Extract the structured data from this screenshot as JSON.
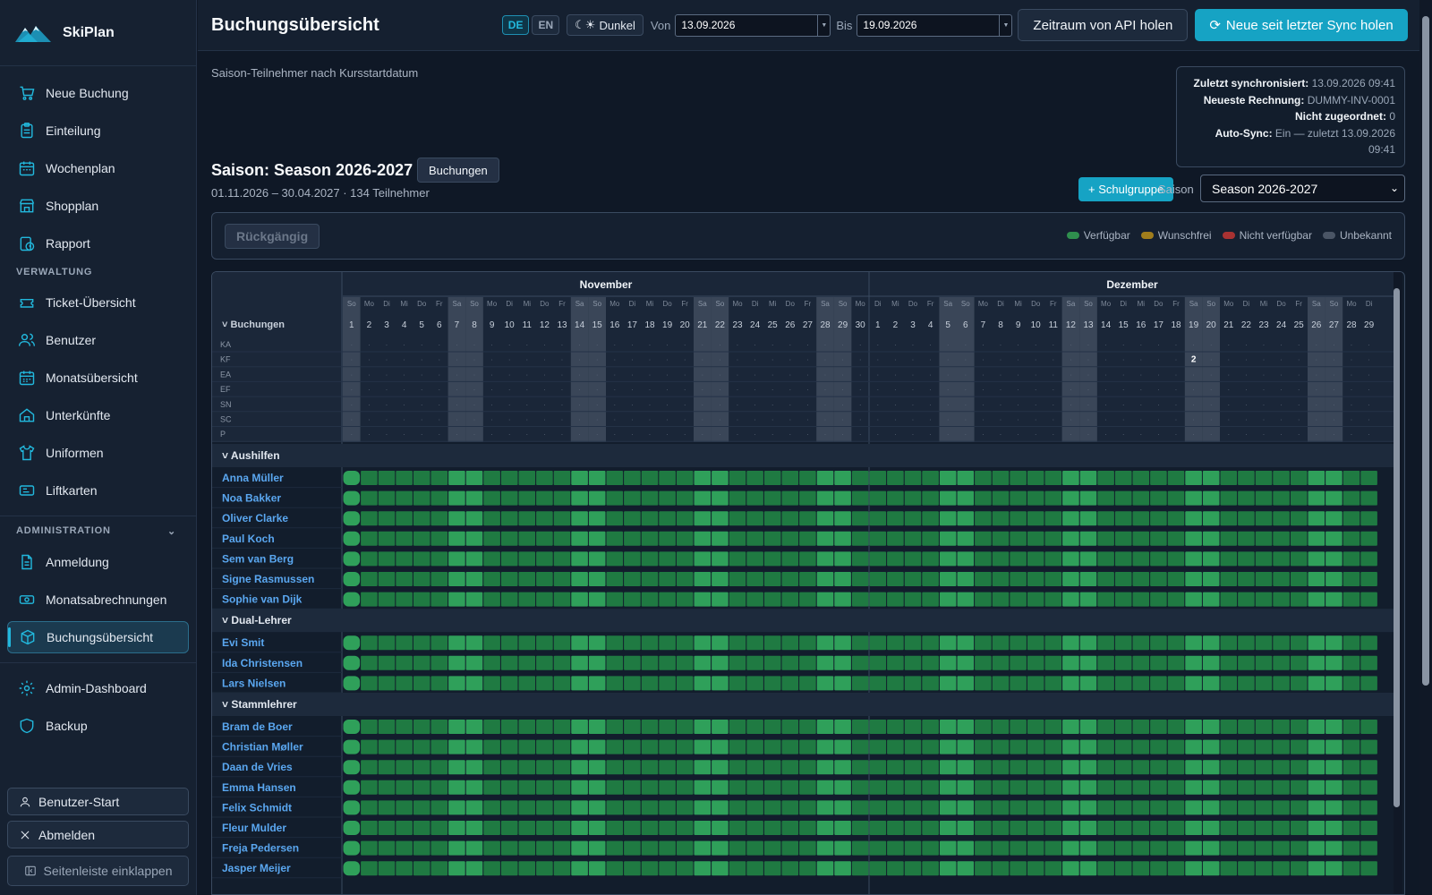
{
  "sidebar": {
    "app_name": "SkiPlan",
    "items": [
      {
        "label": "Neue Buchung",
        "icon": "cart-icon"
      },
      {
        "label": "Einteilung",
        "icon": "clipboard-icon"
      },
      {
        "label": "Wochenplan",
        "icon": "calendar-icon"
      },
      {
        "label": "Shopplan",
        "icon": "store-icon"
      },
      {
        "label": "Rapport",
        "icon": "clock-report-icon"
      }
    ],
    "section_verwaltung": "VERWALTUNG",
    "verwaltung_items": [
      {
        "label": "Ticket-Übersicht",
        "icon": "ticket-icon"
      },
      {
        "label": "Benutzer",
        "icon": "users-icon"
      },
      {
        "label": "Monatsübersicht",
        "icon": "calendar-grid-icon"
      },
      {
        "label": "Unterkünfte",
        "icon": "home-icon"
      },
      {
        "label": "Uniformen",
        "icon": "shirt-icon"
      },
      {
        "label": "Liftkarten",
        "icon": "card-icon"
      }
    ],
    "section_admin": "ADMINISTRATION",
    "admin_items": [
      {
        "label": "Anmeldung",
        "icon": "document-icon"
      },
      {
        "label": "Monatsabrechnungen",
        "icon": "money-icon"
      },
      {
        "label": "Buchungsübersicht",
        "icon": "cube-icon",
        "active": true
      }
    ],
    "bottom_items": [
      {
        "label": "Admin-Dashboard",
        "icon": "gear-icon"
      },
      {
        "label": "Backup",
        "icon": "shield-icon"
      }
    ],
    "user_start": "Benutzer-Start",
    "logout": "Abmelden",
    "collapse": "Seitenleiste einklappen"
  },
  "header": {
    "title": "Buchungsübersicht",
    "lang_de": "DE",
    "lang_en": "EN",
    "theme": "Dunkel",
    "from_label": "Von",
    "from_value": "13.09.2026",
    "to_label": "Bis",
    "to_value": "19.09.2026",
    "fetch_range": "Zeitraum von API holen",
    "fetch_new": "Neue seit letzter Sync holen"
  },
  "content": {
    "subtitle": "Saison-Teilnehmer nach Kursstartdatum",
    "sync": {
      "last_sync_label": "Zuletzt synchronisiert:",
      "last_sync_value": "13.09.2026 09:41",
      "invoice_label": "Neueste Rechnung:",
      "invoice_value": "DUMMY-INV-0001",
      "unassigned_label": "Nicht zugeordnet:",
      "unassigned_value": "0",
      "autosync_label": "Auto-Sync:",
      "autosync_value": "Ein — zuletzt 13.09.2026 09:41"
    },
    "season_title": "Saison: Season 2026-2027",
    "buchungen_button": "Buchungen",
    "season_meta": "01.11.2026 – 30.04.2027 · 134 Teilnehmer",
    "schulgruppe_button": "+ Schulgruppe",
    "saison_label": "Saison",
    "saison_value": "Season 2026-2027",
    "undo": "Rückgängig",
    "legend": [
      {
        "label": "Verfügbar",
        "color": "#2f8f4e"
      },
      {
        "label": "Wunschfrei",
        "color": "#a07d1c"
      },
      {
        "label": "Nicht verfügbar",
        "color": "#a83232"
      },
      {
        "label": "Unbekannt",
        "color": "#4a5565"
      }
    ]
  },
  "grid": {
    "months": [
      "November",
      "Dezember"
    ],
    "booking_header": "Buchungen",
    "booking_rows": [
      "KA",
      "KF",
      "EA",
      "EF",
      "SN",
      "SC",
      "P"
    ],
    "booking_marks": [
      {
        "row": "KF",
        "day": "Sa 19 Dezember",
        "value": "2"
      }
    ],
    "weekday_abbr": [
      "Mo",
      "Di",
      "Mi",
      "Do",
      "Fr",
      "Sa",
      "So"
    ],
    "days_shown": "So 1 November – Di 29 Dezember",
    "groups": [
      {
        "name": "Aushilfen",
        "people": [
          "Anna Müller",
          "Noa Bakker",
          "Oliver Clarke",
          "Paul Koch",
          "Sem van Berg",
          "Signe Rasmussen",
          "Sophie van Dijk"
        ]
      },
      {
        "name": "Dual-Lehrer",
        "people": [
          "Evi Smit",
          "Ida Christensen",
          "Lars Nielsen"
        ]
      },
      {
        "name": "Stammlehrer",
        "people": [
          "Bram de Boer",
          "Christian Møller",
          "Daan de Vries",
          "Emma Hansen",
          "Felix Schmidt",
          "Fleur Mulder",
          "Freja Pedersen",
          "Jasper Meijer"
        ]
      }
    ]
  }
}
